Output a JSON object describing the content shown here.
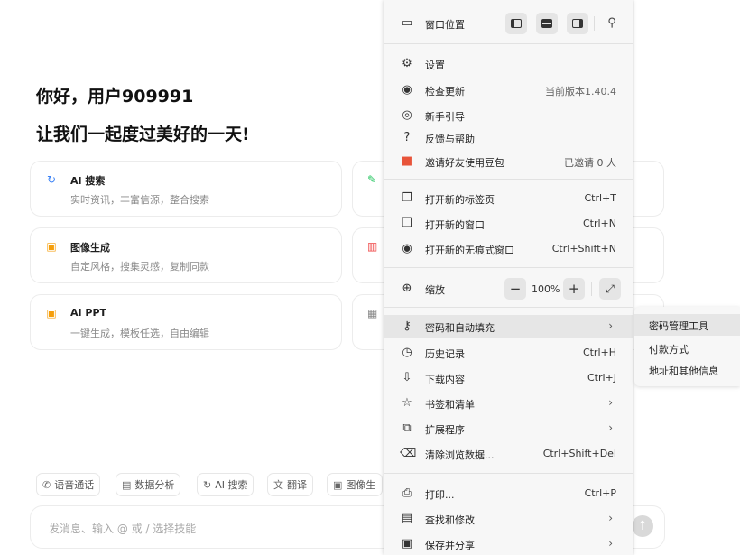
{
  "greeting": {
    "line1": "你好，用户909991",
    "line2": "让我们一起度过美好的一天!"
  },
  "cards": [
    {
      "title": "AI 搜索",
      "subtitle": "实时资讯，丰富信源，整合搜索",
      "icon": "ai-search-icon",
      "color": "#3b82f6"
    },
    {
      "title": "图像生成",
      "subtitle": "自定风格，搜集灵感，复制同款",
      "icon": "image-gen-icon",
      "color": "#f59e0b"
    },
    {
      "title": "AI PPT",
      "subtitle": "一键生成，模板任选，自由编辑",
      "icon": "ppt-icon",
      "color": "#f59e0b"
    }
  ],
  "chips": [
    {
      "label": "语音通话",
      "icon": "phone-icon"
    },
    {
      "label": "数据分析",
      "icon": "chart-icon"
    },
    {
      "label": "AI 搜索",
      "icon": "ai-search-icon"
    },
    {
      "label": "翻译",
      "icon": "translate-icon"
    },
    {
      "label": "图像生",
      "icon": "image-icon"
    }
  ],
  "input": {
    "placeholder": "发消息、输入 @ 或 / 选择技能"
  },
  "menu": {
    "window_position_label": "窗口位置",
    "settings": "设置",
    "check_update": "检查更新",
    "version": "当前版本1.40.4",
    "guide": "新手引导",
    "feedback": "反馈与帮助",
    "invite": "邀请好友使用豆包",
    "invited": "已邀请 0 人",
    "new_tab": "打开新的标签页",
    "new_tab_shortcut": "Ctrl+T",
    "new_window": "打开新的窗口",
    "new_window_shortcut": "Ctrl+N",
    "incognito": "打开新的无痕式窗口",
    "incognito_shortcut": "Ctrl+Shift+N",
    "zoom_label": "缩放",
    "zoom_value": "100%",
    "autofill": "密码和自动填充",
    "history": "历史记录",
    "history_shortcut": "Ctrl+H",
    "downloads": "下载内容",
    "downloads_shortcut": "Ctrl+J",
    "bookmarks": "书签和清单",
    "extensions": "扩展程序",
    "clear_data": "清除浏览数据...",
    "clear_data_shortcut": "Ctrl+Shift+Del",
    "print": "打印...",
    "print_shortcut": "Ctrl+P",
    "find": "查找和修改",
    "save_share": "保存并分享"
  },
  "submenu": {
    "password_manager": "密码管理工具",
    "payment": "付款方式",
    "address": "地址和其他信息"
  },
  "colors": {
    "menu_bg": "#f7f7f7",
    "hover": "#e6e6e6",
    "gift": "#e8543a"
  }
}
